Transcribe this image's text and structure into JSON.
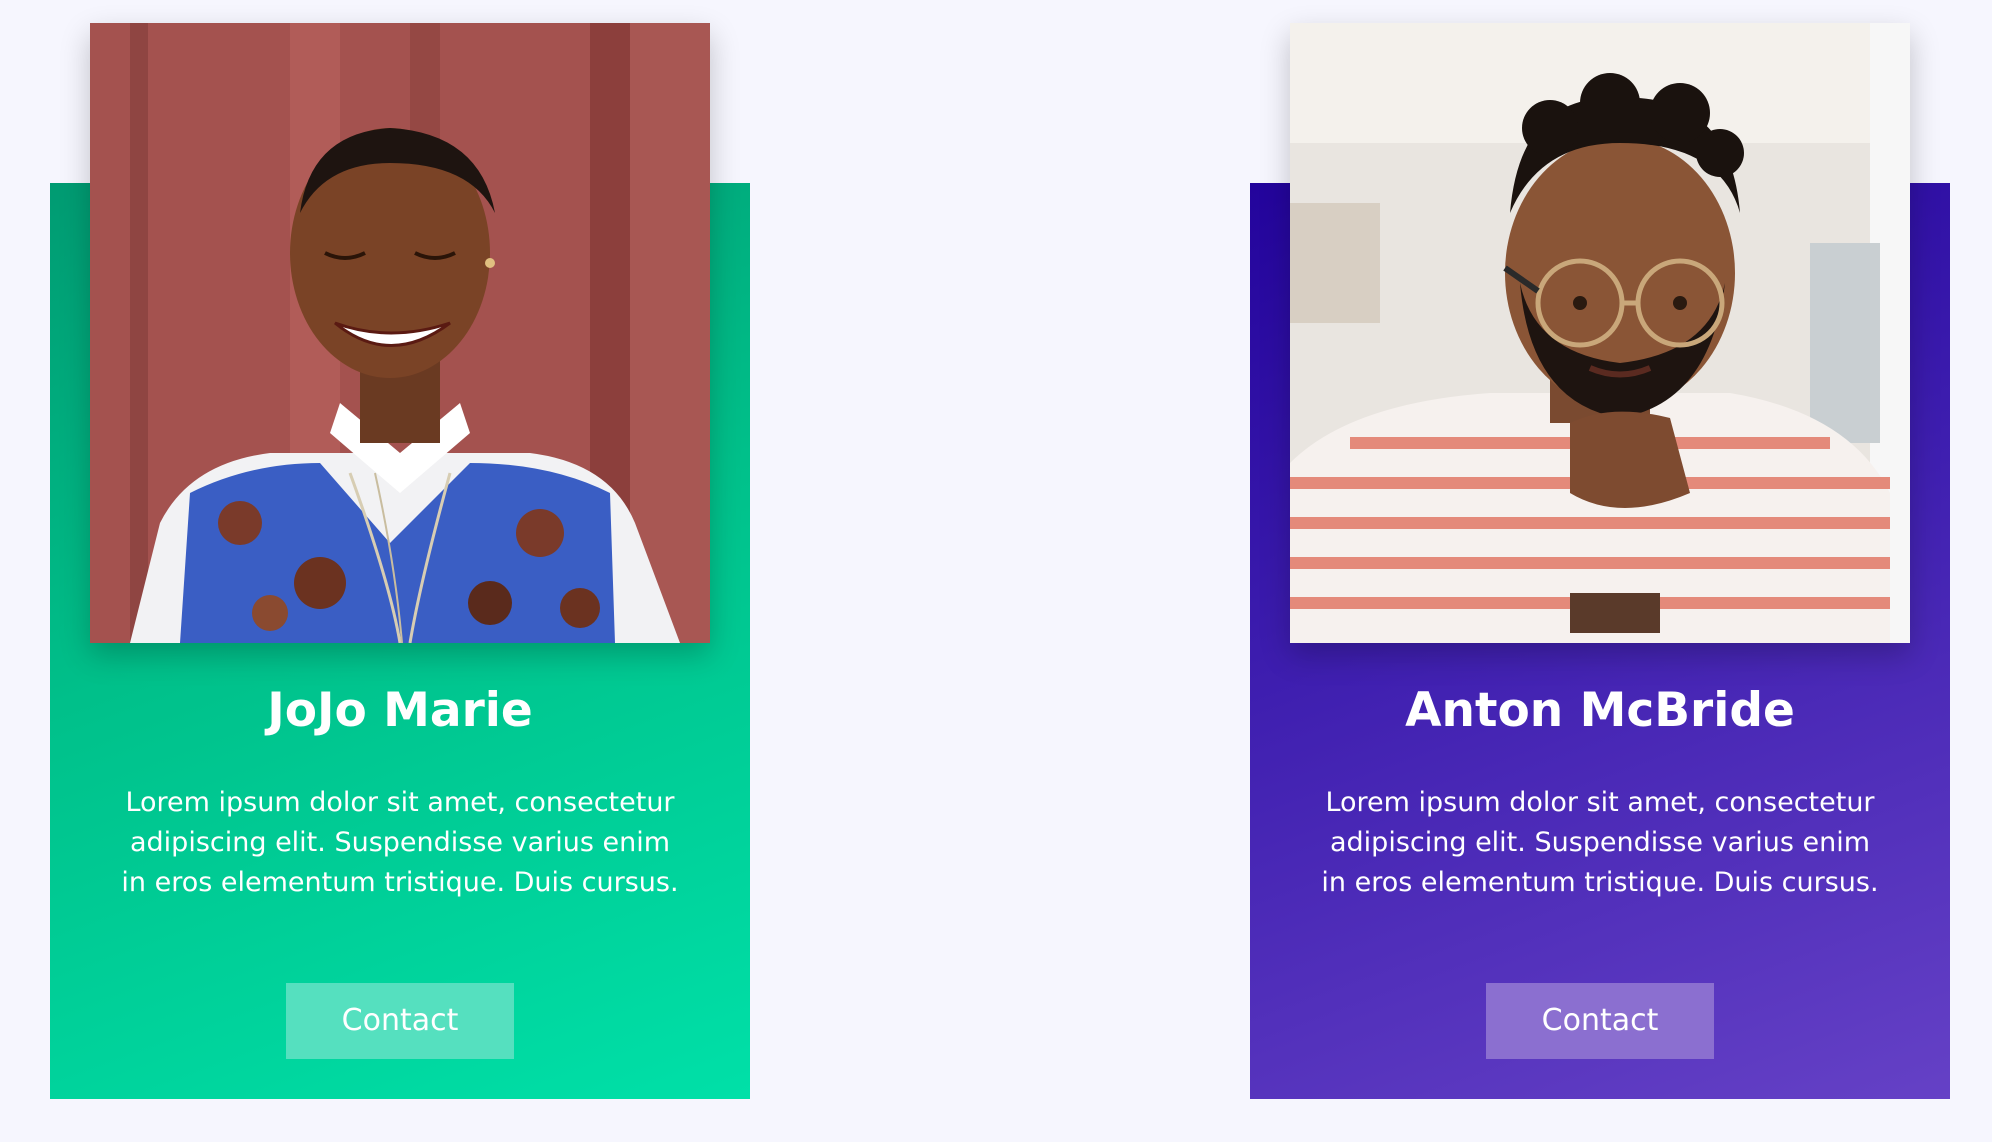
{
  "cards": [
    {
      "name": "JoJo Marie",
      "description": "Lorem ipsum dolor sit amet, consectetur adipiscing elit. Suspendisse varius enim in eros elementum tristique. Duis cursus.",
      "button_label": "Contact",
      "photo_alt": "JoJo Marie portrait",
      "accent_color": "#00c08a"
    },
    {
      "name": "Anton McBride",
      "description": "Lorem ipsum dolor sit amet, consectetur adipiscing elit. Suspendisse varius enim in eros elementum tristique. Duis cursus.",
      "button_label": "Contact",
      "photo_alt": "Anton McBride portrait",
      "accent_color": "#3f1fb0"
    }
  ],
  "colors": {
    "page_background": "#f6f6fe",
    "green_card": "#00c08a",
    "purple_card": "#3f1fb0",
    "green_button": "#55e0bf",
    "purple_button": "#8b6fd0",
    "text": "#ffffff"
  }
}
